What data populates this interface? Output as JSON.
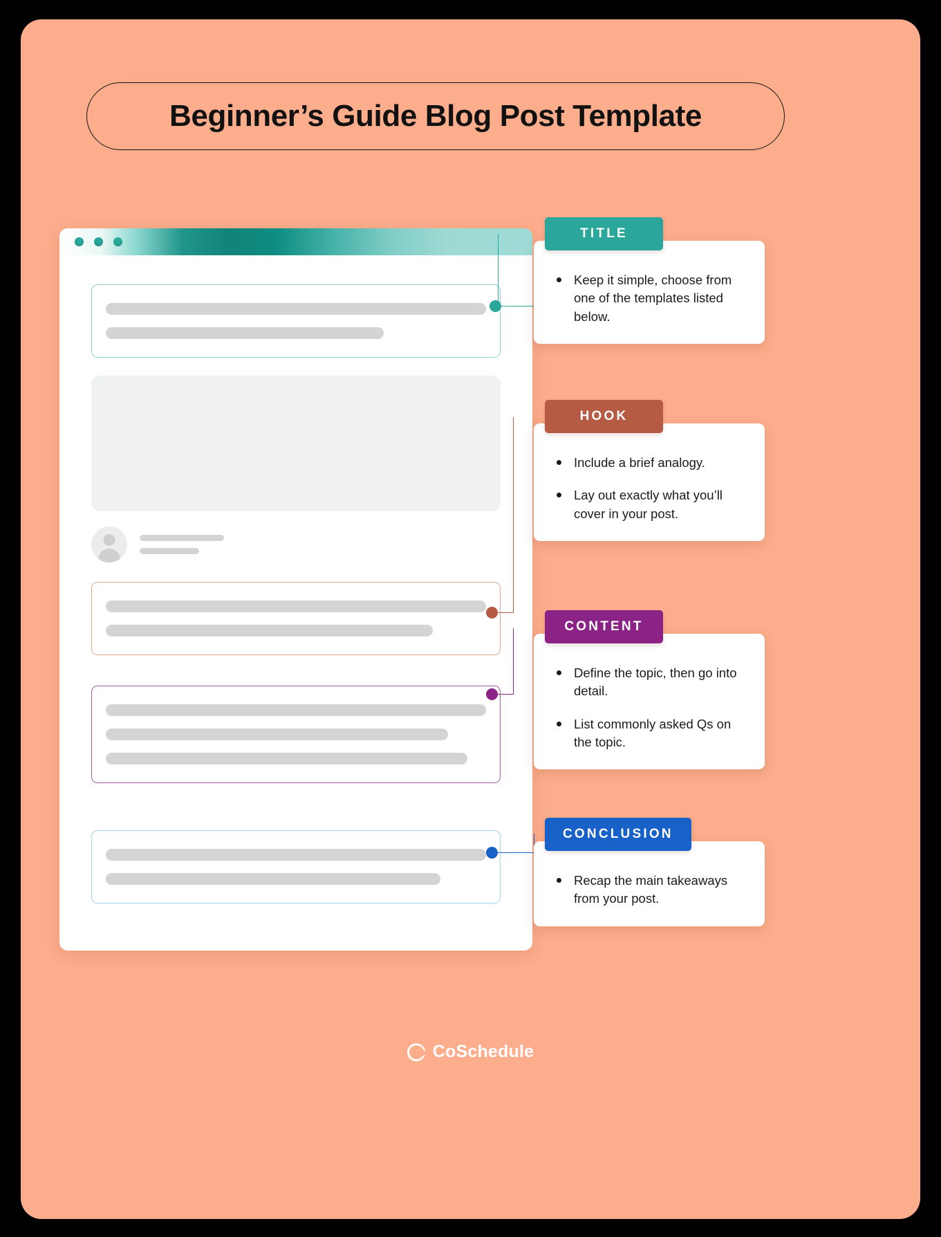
{
  "theme": {
    "page_background": "#000000",
    "canvas_background": "#FCAD8B",
    "card_background": "#FFFFFF",
    "skeleton_gray": "#D4D4D4",
    "hero_gray": "#F0F1F1"
  },
  "header": {
    "title": "Beginner’s Guide Blog Post Template"
  },
  "mockup": {
    "window_dots": [
      "dot-1",
      "dot-2",
      "dot-3"
    ],
    "bar_gradient_from": "#FFFFFF",
    "bar_gradient_mid": "#0F8D82",
    "bar_gradient_to": "#9FDCD7",
    "sections": [
      {
        "name": "title-skeleton",
        "border_color": "#8ED4CD",
        "bars": 2
      },
      {
        "name": "hero-image-block",
        "border_color": "none",
        "bars": 0
      },
      {
        "name": "author-row",
        "border_color": "none",
        "bars": 2
      },
      {
        "name": "hook-skeleton",
        "border_color": "#E0A98E",
        "bars": 2
      },
      {
        "name": "content-skeleton",
        "border_color": "#A05BA0",
        "bars": 3
      },
      {
        "name": "conclusion-skeleton",
        "border_color": "#9DD6E6",
        "bars": 2
      }
    ]
  },
  "callouts": [
    {
      "id": "title",
      "label": "TITLE",
      "color": "#2AA69A",
      "bullets": [
        "Keep it simple, choose from one of the templates listed below."
      ]
    },
    {
      "id": "hook",
      "label": "HOOK",
      "color": "#B65B43",
      "bullets": [
        "Include a brief analogy.",
        "Lay out exactly what you’ll cover in your post."
      ]
    },
    {
      "id": "content",
      "label": "CONTENT",
      "color": "#8B2387",
      "bullets": [
        "Define the topic, then go into detail.",
        "List commonly asked Qs on the topic."
      ]
    },
    {
      "id": "conclusion",
      "label": "CONCLUSION",
      "color": "#1761C8",
      "bullets": [
        "Recap the main takeaways from your post."
      ]
    }
  ],
  "footer": {
    "brand": "CoSchedule",
    "logo_icon": "coschedule-logo-icon"
  }
}
